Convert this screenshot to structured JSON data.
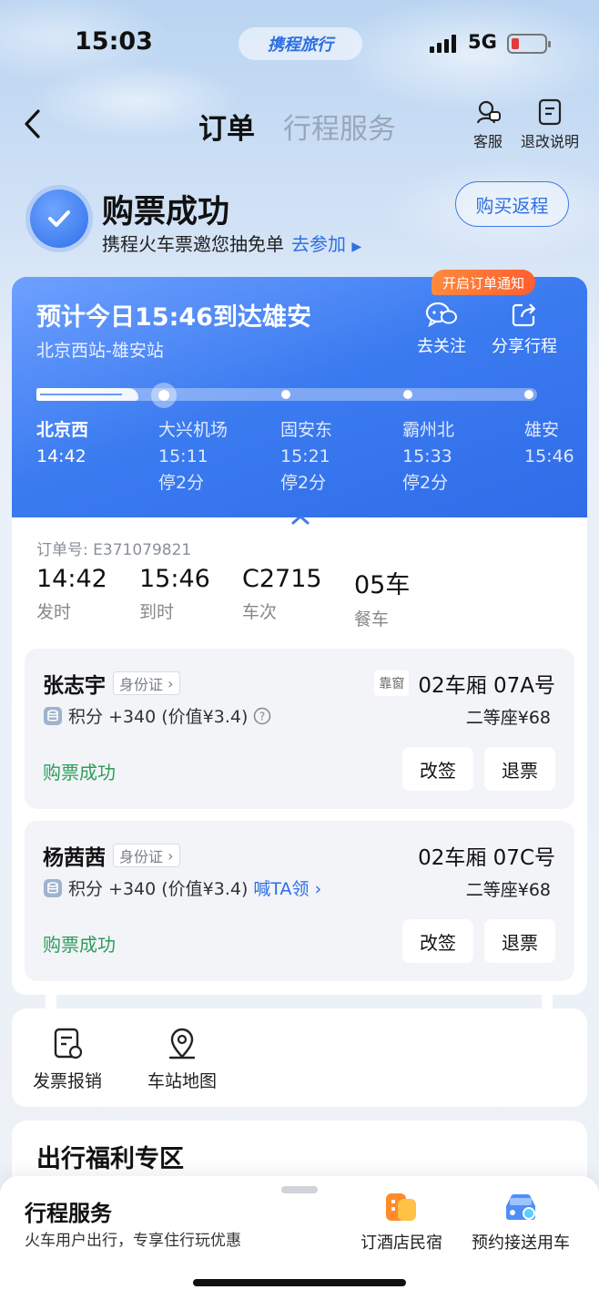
{
  "status": {
    "time": "15:03",
    "brand": "携程旅行",
    "network": "5G"
  },
  "nav": {
    "tab_active": "订单",
    "tab_inactive": "行程服务",
    "service_label": "客服",
    "rules_label": "退改说明"
  },
  "success": {
    "title": "购票成功",
    "subtitle": "携程火车票邀您抽免单",
    "link": "去参加",
    "rebuy_button": "购买返程"
  },
  "trip": {
    "arrival_text": "预计今日15:46到达雄安",
    "route": "北京西站-雄安站",
    "notice_badge": "开启订单通知",
    "follow_label": "去关注",
    "share_label": "分享行程",
    "stations": [
      {
        "name": "北京西",
        "time": "14:42",
        "stop": ""
      },
      {
        "name": "大兴机场",
        "time": "15:11",
        "stop": "停2分"
      },
      {
        "name": "固安东",
        "time": "15:21",
        "stop": "停2分"
      },
      {
        "name": "霸州北",
        "time": "15:33",
        "stop": "停2分"
      },
      {
        "name": "雄安",
        "time": "15:46",
        "stop": ""
      }
    ]
  },
  "order": {
    "number_label": "订单号: E371079821",
    "fields": [
      {
        "value": "14:42",
        "label": "发时"
      },
      {
        "value": "15:46",
        "label": "到时"
      },
      {
        "value": "C2715",
        "label": "车次"
      },
      {
        "value": "05车",
        "label": "餐车"
      }
    ]
  },
  "passengers": [
    {
      "name": "张志宇",
      "id_type": "身份证",
      "window_tag": "靠窗",
      "seat": "02车厢 07A号",
      "points": "积分 +340 (价值¥3.4)",
      "extra_link": "",
      "price": "二等座¥68",
      "status": "购票成功",
      "change_button": "改签",
      "refund_button": "退票"
    },
    {
      "name": "杨茜茜",
      "id_type": "身份证",
      "window_tag": "",
      "seat": "02车厢 07C号",
      "points": "积分 +340 (价值¥3.4)",
      "extra_link": "喊TA领",
      "price": "二等座¥68",
      "status": "购票成功",
      "change_button": "改签",
      "refund_button": "退票"
    }
  ],
  "tools": [
    {
      "label": "发票报销",
      "icon": "invoice-icon"
    },
    {
      "label": "车站地图",
      "icon": "map-pin-icon"
    }
  ],
  "welfare": {
    "title": "出行福利专区"
  },
  "bottom_sheet": {
    "title": "行程服务",
    "subtitle": "火车用户出行，专享住行玩优惠",
    "items": [
      {
        "label": "订酒店民宿",
        "icon": "hotel-icon"
      },
      {
        "label": "预约接送用车",
        "icon": "car-icon"
      }
    ]
  },
  "colors": {
    "accent": "#2e6fe3",
    "success": "#2e9d5a",
    "badge": "#ff6a33",
    "card": "#3b7bf0"
  }
}
